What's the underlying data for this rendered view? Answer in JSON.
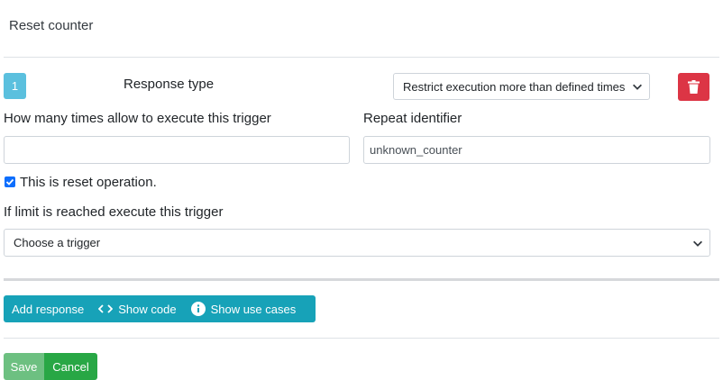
{
  "page": {
    "title": "Reset counter"
  },
  "response": {
    "index": "1",
    "type_label": "Response type",
    "type_selected": "Restrict execution more than defined times",
    "times_label": "How many times allow to execute this trigger",
    "times_value": "",
    "repeat_label": "Repeat identifier",
    "repeat_value": "unknown_counter",
    "reset_checkbox_label": "This is reset operation.",
    "reset_checked": true,
    "limit_label": "If limit is reached execute this trigger",
    "trigger_selected": "Choose a trigger"
  },
  "actions": {
    "add_response": "Add response",
    "show_code": "Show code",
    "show_use_cases": "Show use cases"
  },
  "footer": {
    "save": "Save",
    "cancel": "Cancel"
  },
  "colors": {
    "index_badge": "#5bc0de",
    "delete": "#dc3545",
    "info_group": "#17a2b8",
    "save": "#6dc081",
    "cancel": "#28a745",
    "checkbox": "#0d6efd"
  },
  "icons": {
    "delete": "trash-icon",
    "code": "code-brackets-icon",
    "info": "info-circle-icon",
    "dropdown": "chevron-down-icon",
    "check": "check-icon"
  }
}
